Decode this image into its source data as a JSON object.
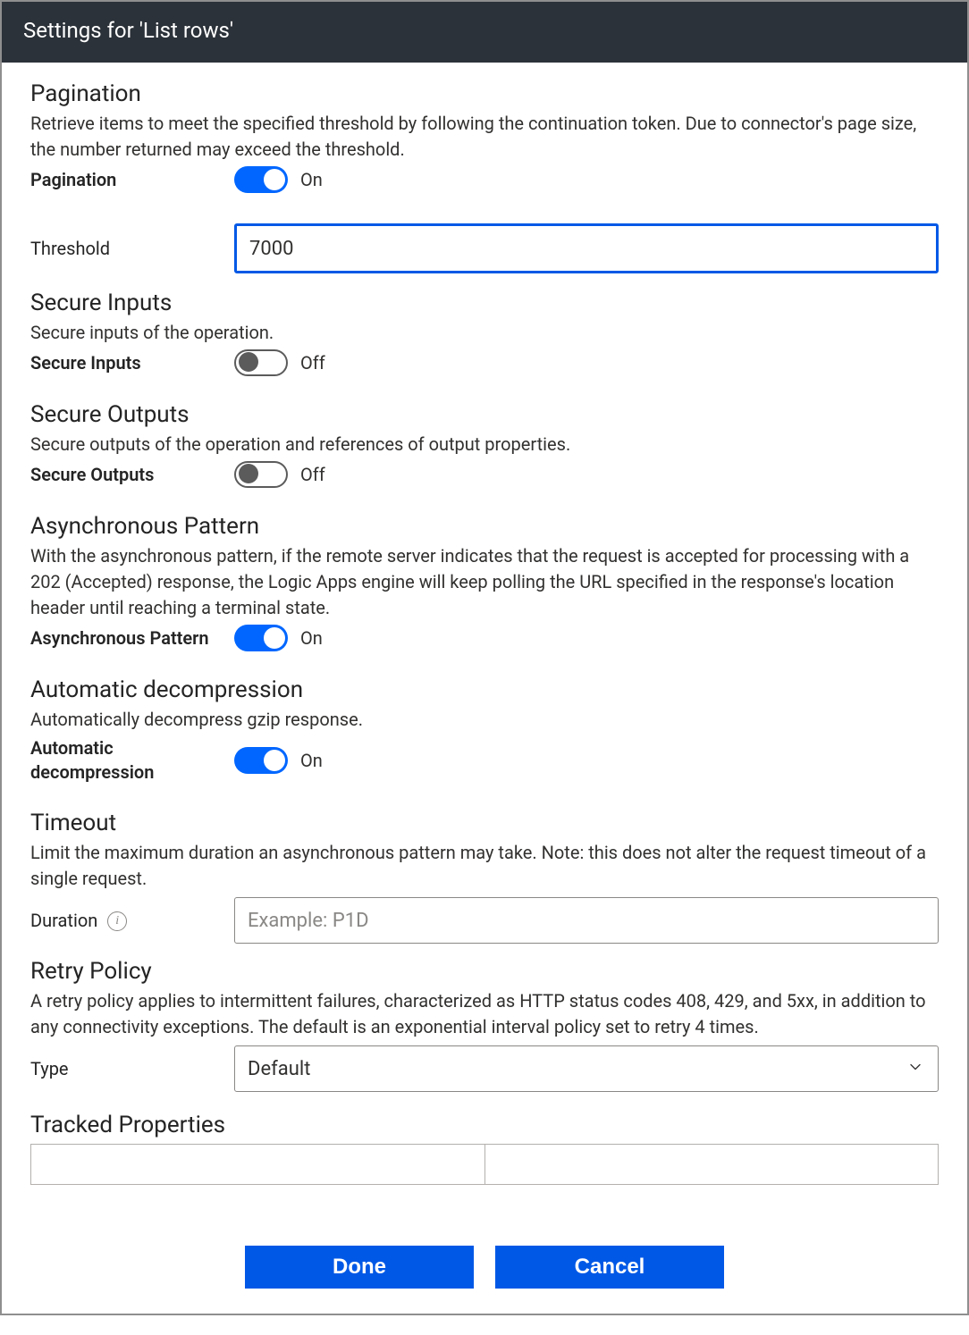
{
  "header": {
    "title": "Settings for 'List rows'"
  },
  "pagination": {
    "title": "Pagination",
    "desc": "Retrieve items to meet the specified threshold by following the continuation token. Due to connector's page size, the number returned may exceed the threshold.",
    "label": "Pagination",
    "toggle_state": "On",
    "threshold_label": "Threshold",
    "threshold_value": "7000"
  },
  "secure_inputs": {
    "title": "Secure Inputs",
    "desc": "Secure inputs of the operation.",
    "label": "Secure Inputs",
    "toggle_state": "Off"
  },
  "secure_outputs": {
    "title": "Secure Outputs",
    "desc": "Secure outputs of the operation and references of output properties.",
    "label": "Secure Outputs",
    "toggle_state": "Off"
  },
  "async_pattern": {
    "title": "Asynchronous Pattern",
    "desc": "With the asynchronous pattern, if the remote server indicates that the request is accepted for processing with a 202 (Accepted) response, the Logic Apps engine will keep polling the URL specified in the response's location header until reaching a terminal state.",
    "label": "Asynchronous Pattern",
    "toggle_state": "On"
  },
  "auto_decompress": {
    "title": "Automatic decompression",
    "desc": "Automatically decompress gzip response.",
    "label": "Automatic decompression",
    "toggle_state": "On"
  },
  "timeout": {
    "title": "Timeout",
    "desc": "Limit the maximum duration an asynchronous pattern may take. Note: this does not alter the request timeout of a single request.",
    "duration_label": "Duration",
    "duration_placeholder": "Example: P1D"
  },
  "retry_policy": {
    "title": "Retry Policy",
    "desc": "A retry policy applies to intermittent failures, characterized as HTTP status codes 408, 429, and 5xx, in addition to any connectivity exceptions. The default is an exponential interval policy set to retry 4 times.",
    "type_label": "Type",
    "type_value": "Default"
  },
  "tracked_properties": {
    "title": "Tracked Properties"
  },
  "footer": {
    "done": "Done",
    "cancel": "Cancel"
  },
  "info_glyph": "i"
}
